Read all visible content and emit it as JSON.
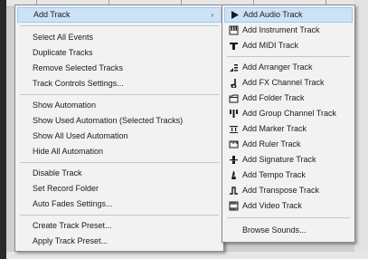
{
  "main_menu": {
    "items": [
      {
        "label": "Add Track",
        "has_submenu": true
      },
      {
        "label": "Select All Events"
      },
      {
        "label": "Duplicate Tracks"
      },
      {
        "label": "Remove Selected Tracks"
      },
      {
        "label": "Track Controls Settings..."
      },
      {
        "label": "Show Automation"
      },
      {
        "label": "Show Used Automation (Selected Tracks)"
      },
      {
        "label": "Show All Used Automation"
      },
      {
        "label": "Hide All Automation"
      },
      {
        "label": "Disable Track"
      },
      {
        "label": "Set Record Folder"
      },
      {
        "label": "Auto Fades Settings..."
      },
      {
        "label": "Create Track Preset..."
      },
      {
        "label": "Apply Track Preset..."
      }
    ],
    "submenu_arrow": "›"
  },
  "sub_menu": {
    "items": [
      {
        "label": "Add Audio Track",
        "icon": "audio-track-icon"
      },
      {
        "label": "Add Instrument Track",
        "icon": "instrument-track-icon"
      },
      {
        "label": "Add MIDI Track",
        "icon": "midi-track-icon"
      },
      {
        "label": "Add Arranger Track",
        "icon": "arranger-track-icon"
      },
      {
        "label": "Add FX Channel Track",
        "icon": "fx-channel-track-icon"
      },
      {
        "label": "Add Folder Track",
        "icon": "folder-track-icon"
      },
      {
        "label": "Add Group Channel Track",
        "icon": "group-channel-track-icon"
      },
      {
        "label": "Add Marker Track",
        "icon": "marker-track-icon"
      },
      {
        "label": "Add Ruler Track",
        "icon": "ruler-track-icon"
      },
      {
        "label": "Add Signature Track",
        "icon": "signature-track-icon"
      },
      {
        "label": "Add Tempo Track",
        "icon": "tempo-track-icon"
      },
      {
        "label": "Add Transpose Track",
        "icon": "transpose-track-icon"
      },
      {
        "label": "Add Video Track",
        "icon": "video-track-icon"
      },
      {
        "label": "Browse Sounds..."
      }
    ]
  },
  "colors": {
    "highlight": "#cce3f7",
    "menu_bg": "#f2f2f2",
    "separator": "#c6c6c6"
  }
}
